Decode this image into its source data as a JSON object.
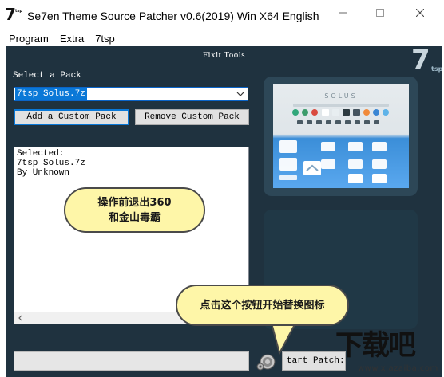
{
  "window": {
    "title": "Se7en Theme Source Patcher v0.6(2019) Win X64 English",
    "icon_text": "7",
    "icon_small_text": "tsp"
  },
  "menu": {
    "items": [
      {
        "label": "Program"
      },
      {
        "label": "Extra"
      },
      {
        "label": "7tsp"
      }
    ]
  },
  "main": {
    "section_title": "Fixit Tools",
    "brand_logo": {
      "big": "7",
      "small": "tsp"
    },
    "select_label": "Select a Pack",
    "pack_select": {
      "value": "7tsp Solus.7z"
    },
    "add_button": "Add a Custom Pack",
    "remove_button": "Remove Custom Pack",
    "info_lines": [
      "Selected:",
      "7tsp Solus.7z",
      "By Unknown"
    ],
    "start_button": "tart Patch:",
    "preview_brand": "SOLUS",
    "progress_fraction": 0
  },
  "callouts": {
    "first": [
      "操作前退出360",
      "和金山毒霸"
    ],
    "second": "点击这个按钮开始替换图标"
  },
  "watermark": {
    "big": "下载吧",
    "small": "www.xiazaiba.com"
  },
  "colors": {
    "panel_bg": "#1f323f",
    "accent": "#0a78d7",
    "callout_bg": "#fef6a8"
  }
}
